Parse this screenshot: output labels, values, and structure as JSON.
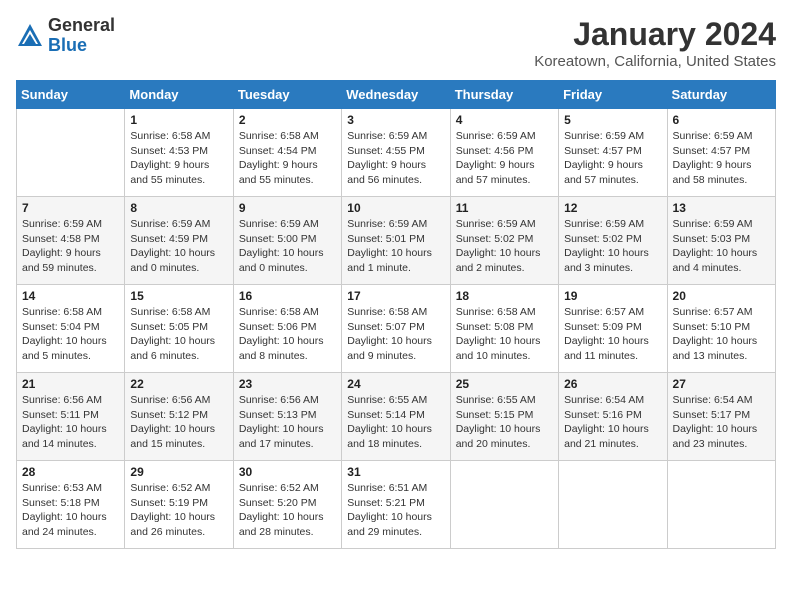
{
  "header": {
    "logo_general": "General",
    "logo_blue": "Blue",
    "title": "January 2024",
    "subtitle": "Koreatown, California, United States"
  },
  "days_of_week": [
    "Sunday",
    "Monday",
    "Tuesday",
    "Wednesday",
    "Thursday",
    "Friday",
    "Saturday"
  ],
  "weeks": [
    [
      {
        "day": "",
        "info": ""
      },
      {
        "day": "1",
        "info": "Sunrise: 6:58 AM\nSunset: 4:53 PM\nDaylight: 9 hours\nand 55 minutes."
      },
      {
        "day": "2",
        "info": "Sunrise: 6:58 AM\nSunset: 4:54 PM\nDaylight: 9 hours\nand 55 minutes."
      },
      {
        "day": "3",
        "info": "Sunrise: 6:59 AM\nSunset: 4:55 PM\nDaylight: 9 hours\nand 56 minutes."
      },
      {
        "day": "4",
        "info": "Sunrise: 6:59 AM\nSunset: 4:56 PM\nDaylight: 9 hours\nand 57 minutes."
      },
      {
        "day": "5",
        "info": "Sunrise: 6:59 AM\nSunset: 4:57 PM\nDaylight: 9 hours\nand 57 minutes."
      },
      {
        "day": "6",
        "info": "Sunrise: 6:59 AM\nSunset: 4:57 PM\nDaylight: 9 hours\nand 58 minutes."
      }
    ],
    [
      {
        "day": "7",
        "info": "Sunrise: 6:59 AM\nSunset: 4:58 PM\nDaylight: 9 hours\nand 59 minutes."
      },
      {
        "day": "8",
        "info": "Sunrise: 6:59 AM\nSunset: 4:59 PM\nDaylight: 10 hours\nand 0 minutes."
      },
      {
        "day": "9",
        "info": "Sunrise: 6:59 AM\nSunset: 5:00 PM\nDaylight: 10 hours\nand 0 minutes."
      },
      {
        "day": "10",
        "info": "Sunrise: 6:59 AM\nSunset: 5:01 PM\nDaylight: 10 hours\nand 1 minute."
      },
      {
        "day": "11",
        "info": "Sunrise: 6:59 AM\nSunset: 5:02 PM\nDaylight: 10 hours\nand 2 minutes."
      },
      {
        "day": "12",
        "info": "Sunrise: 6:59 AM\nSunset: 5:02 PM\nDaylight: 10 hours\nand 3 minutes."
      },
      {
        "day": "13",
        "info": "Sunrise: 6:59 AM\nSunset: 5:03 PM\nDaylight: 10 hours\nand 4 minutes."
      }
    ],
    [
      {
        "day": "14",
        "info": "Sunrise: 6:58 AM\nSunset: 5:04 PM\nDaylight: 10 hours\nand 5 minutes."
      },
      {
        "day": "15",
        "info": "Sunrise: 6:58 AM\nSunset: 5:05 PM\nDaylight: 10 hours\nand 6 minutes."
      },
      {
        "day": "16",
        "info": "Sunrise: 6:58 AM\nSunset: 5:06 PM\nDaylight: 10 hours\nand 8 minutes."
      },
      {
        "day": "17",
        "info": "Sunrise: 6:58 AM\nSunset: 5:07 PM\nDaylight: 10 hours\nand 9 minutes."
      },
      {
        "day": "18",
        "info": "Sunrise: 6:58 AM\nSunset: 5:08 PM\nDaylight: 10 hours\nand 10 minutes."
      },
      {
        "day": "19",
        "info": "Sunrise: 6:57 AM\nSunset: 5:09 PM\nDaylight: 10 hours\nand 11 minutes."
      },
      {
        "day": "20",
        "info": "Sunrise: 6:57 AM\nSunset: 5:10 PM\nDaylight: 10 hours\nand 13 minutes."
      }
    ],
    [
      {
        "day": "21",
        "info": "Sunrise: 6:56 AM\nSunset: 5:11 PM\nDaylight: 10 hours\nand 14 minutes."
      },
      {
        "day": "22",
        "info": "Sunrise: 6:56 AM\nSunset: 5:12 PM\nDaylight: 10 hours\nand 15 minutes."
      },
      {
        "day": "23",
        "info": "Sunrise: 6:56 AM\nSunset: 5:13 PM\nDaylight: 10 hours\nand 17 minutes."
      },
      {
        "day": "24",
        "info": "Sunrise: 6:55 AM\nSunset: 5:14 PM\nDaylight: 10 hours\nand 18 minutes."
      },
      {
        "day": "25",
        "info": "Sunrise: 6:55 AM\nSunset: 5:15 PM\nDaylight: 10 hours\nand 20 minutes."
      },
      {
        "day": "26",
        "info": "Sunrise: 6:54 AM\nSunset: 5:16 PM\nDaylight: 10 hours\nand 21 minutes."
      },
      {
        "day": "27",
        "info": "Sunrise: 6:54 AM\nSunset: 5:17 PM\nDaylight: 10 hours\nand 23 minutes."
      }
    ],
    [
      {
        "day": "28",
        "info": "Sunrise: 6:53 AM\nSunset: 5:18 PM\nDaylight: 10 hours\nand 24 minutes."
      },
      {
        "day": "29",
        "info": "Sunrise: 6:52 AM\nSunset: 5:19 PM\nDaylight: 10 hours\nand 26 minutes."
      },
      {
        "day": "30",
        "info": "Sunrise: 6:52 AM\nSunset: 5:20 PM\nDaylight: 10 hours\nand 28 minutes."
      },
      {
        "day": "31",
        "info": "Sunrise: 6:51 AM\nSunset: 5:21 PM\nDaylight: 10 hours\nand 29 minutes."
      },
      {
        "day": "",
        "info": ""
      },
      {
        "day": "",
        "info": ""
      },
      {
        "day": "",
        "info": ""
      }
    ]
  ]
}
